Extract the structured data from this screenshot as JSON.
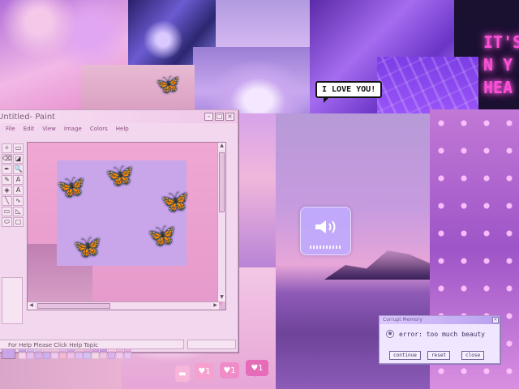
{
  "speech_bubble": {
    "text": "I LOVE YOU!"
  },
  "neon_sign": {
    "lines": [
      "IT'S",
      "N Y",
      "HEA"
    ]
  },
  "paint_window": {
    "title": "Untitled- Paint",
    "menus": [
      "File",
      "Edit",
      "View",
      "Image",
      "Colors",
      "Help"
    ],
    "status_text": "For Help Please Click Help Topic",
    "tools": [
      "✧",
      "▭",
      "⌫",
      "◪",
      "✒",
      "🔍",
      "✎",
      "A",
      "◈",
      "A",
      "╲",
      "∿",
      "▭",
      "◺",
      "⬭",
      "▢"
    ],
    "palette": {
      "current_color": "#c9a6ea",
      "colors": [
        "#c9a6ea",
        "#d8b7f0",
        "#e1c0ef",
        "#f0c3e6",
        "#f5c7de",
        "#e8b7ed",
        "#d4a7e6",
        "#f2bfe1",
        "#e9b2e0",
        "#d9a2e3",
        "#c99de7",
        "#f7cbe6",
        "#eeb9dd",
        "#e7afe3",
        "#f6d2ee",
        "#e6c0f2",
        "#d6b1ec",
        "#ccb1f2",
        "#f0c9f0",
        "#f4b8d7",
        "#eec1e9",
        "#e2bdf5",
        "#d6c1f5",
        "#f6d6ea",
        "#f1c4e5",
        "#ddb2ed",
        "#f4c9ee",
        "#e9c3f2"
      ]
    }
  },
  "volume_popup": {
    "icon": "speaker-icon"
  },
  "error_dialog": {
    "title": "Corrupt Memory",
    "message": "error: too much beauty",
    "buttons": [
      "continue",
      "reset",
      "close"
    ],
    "close_glyph": "×"
  },
  "notifications": [
    {
      "icon": "chat-icon",
      "count": ""
    },
    {
      "icon": "heart-icon",
      "count": "1"
    },
    {
      "icon": "heart-icon",
      "count": "1"
    },
    {
      "icon": "heart-icon",
      "count": "1"
    }
  ]
}
